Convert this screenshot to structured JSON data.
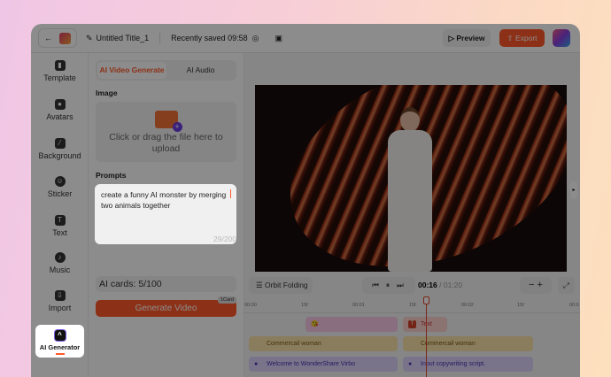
{
  "header": {
    "title": "Untitled Title_1",
    "saved": "Recently saved 09:58",
    "preview": "Preview",
    "export": "Export"
  },
  "sidebar": {
    "items": [
      {
        "label": "Template",
        "icon": "template-icon"
      },
      {
        "label": "Avatars",
        "icon": "avatar-icon"
      },
      {
        "label": "Background",
        "icon": "background-icon"
      },
      {
        "label": "Sticker",
        "icon": "sticker-icon"
      },
      {
        "label": "Text",
        "icon": "text-icon"
      },
      {
        "label": "Music",
        "icon": "music-icon"
      },
      {
        "label": "Import",
        "icon": "import-icon"
      },
      {
        "label": "AI Generator",
        "icon": "ai-generator-icon",
        "active": true
      }
    ]
  },
  "panel": {
    "tabs": [
      "AI Video Generate",
      "AI Audio"
    ],
    "image_label": "Image",
    "upload_text": "Click or drag the file here to upload",
    "prompts_label": "Prompts",
    "prompt_value": "create a funny AI monster by merging two animals together",
    "char_count": "29/200",
    "cards": "AI cards: 5/100",
    "generate": "Generate Video",
    "card_badge": "1Card",
    "accent": "#ff5a2a"
  },
  "player": {
    "orbit": "Orbit Folding",
    "current": "00:16",
    "total": "/ 01:20"
  },
  "timeline": {
    "ruler": [
      "00:00",
      "15f",
      "00:01",
      "15f",
      "00:02",
      "15f",
      "00:0"
    ],
    "clips": {
      "text": "Text",
      "avatar1": "Commercail woman",
      "avatar2": "Commercail woman",
      "script1": "Welcome to WonderShare Virbo",
      "script2": "Input copywriting script."
    }
  }
}
